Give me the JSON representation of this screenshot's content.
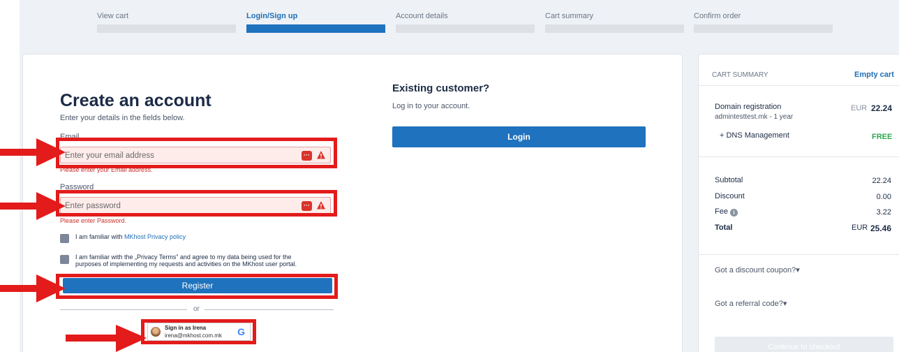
{
  "steps": [
    {
      "label": "View cart",
      "active": false
    },
    {
      "label": "Login/Sign up",
      "active": true
    },
    {
      "label": "Account details",
      "active": false
    },
    {
      "label": "Cart summary",
      "active": false
    },
    {
      "label": "Confirm order",
      "active": false
    }
  ],
  "create": {
    "title": "Create an account",
    "subtitle": "Enter your details in the fields below.",
    "email_label": "Email",
    "email_placeholder": "Enter your email address",
    "email_error": "Please enter your Email address.",
    "password_label": "Password",
    "password_placeholder": "Enter password",
    "password_error": "Please enter Password.",
    "check1_prefix": "I am familiar with",
    "check1_link": "MKhost Privacy policy",
    "check2_line1": "I am familiar with the „Privacy Terms” and agree to my data being used for the",
    "check2_line2": "purposes of implementing my requests and activities on the MKhost user portal.",
    "register_label": "Register",
    "or_label": "or",
    "google_name": "Sign in as Irena",
    "google_email": "irena@mkhost.com.mk",
    "google_logo": "G"
  },
  "existing": {
    "title": "Existing customer?",
    "subtitle": "Log in to your account.",
    "login_label": "Login"
  },
  "summary": {
    "heading": "CART SUMMARY",
    "empty_label": "Empty cart",
    "item_name": "Domain registration",
    "item_desc": "admintesttest.mk - 1 year",
    "item_currency": "EUR",
    "item_price": "22.24",
    "addon_name": "+ DNS Management",
    "addon_price": "FREE",
    "subtotal_label": "Subtotal",
    "subtotal_value": "22.24",
    "discount_label": "Discount",
    "discount_value": "0.00",
    "fee_label": "Fee",
    "fee_value": "3.22",
    "total_label": "Total",
    "total_currency": "EUR",
    "total_value": "25.46",
    "coupon_label": "Got a discount coupon?▾",
    "referral_label": "Got a referral code?▾",
    "checkout_label": "Continue to checkout"
  },
  "colors": {
    "accent": "#1f72bd",
    "annotation_red": "#e31b1b",
    "error": "#c9302c",
    "free_green": "#2fa84f"
  }
}
